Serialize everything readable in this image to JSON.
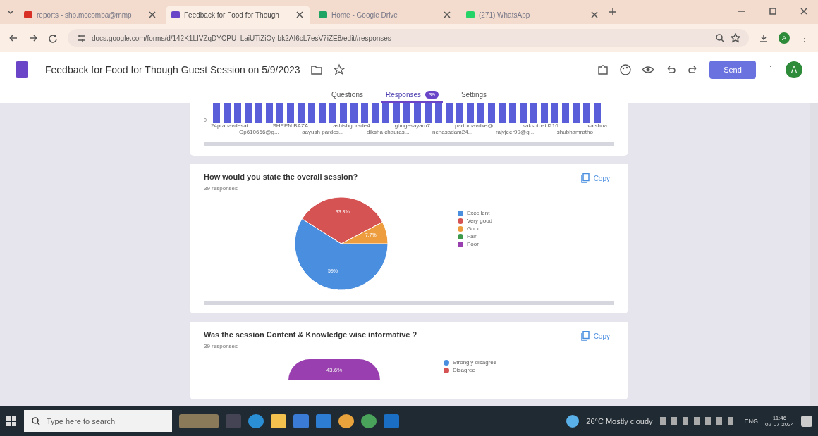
{
  "browser": {
    "tabs": [
      {
        "title": "reports - shp.mccomba@mmp",
        "selected": false
      },
      {
        "title": "Feedback for Food for Though",
        "selected": true
      },
      {
        "title": "Home - Google Drive",
        "selected": false
      },
      {
        "title": "(271) WhatsApp",
        "selected": false
      }
    ],
    "url": "docs.google.com/forms/d/142K1LIVZqDYCPU_LaiUTiZiOy-bk2AI6cL7esV7iZE8/edit#responses",
    "profile_initial": "A"
  },
  "form": {
    "title": "Feedback for Food for Though Guest Session on 5/9/2023",
    "send_label": "Send",
    "avatar_initial": "A",
    "tabs": [
      {
        "label": "Questions",
        "selected": false
      },
      {
        "label": "Responses",
        "badge": "39",
        "selected": true
      },
      {
        "label": "Settings",
        "selected": false
      }
    ]
  },
  "name_chart": {
    "axis_zero": "0",
    "labels_row_1": [
      "24pranavdesai",
      "SHEEN BAZA",
      "ashishgorade4",
      "ghugesayam7",
      "parthmavdke@...",
      "sakshipatil216...",
      "vaishna"
    ],
    "labels_row_2": [
      "Gp610666@g...",
      "aayush pardes...",
      "diksha chauras...",
      "nehasadam24...",
      "rajvjeer99@g...",
      "shubhamratho"
    ]
  },
  "questions": [
    {
      "title": "How would you state the overall session?",
      "responses": "39 responses",
      "copy_label": "Copy",
      "chart_data": {
        "type": "pie",
        "categories": [
          "Excellent",
          "Very good",
          "Good",
          "Fair",
          "Poor"
        ],
        "colors": [
          "#4a8ee0",
          "#d55353",
          "#ee9d3e",
          "#3d9a4a",
          "#9a3fb0"
        ],
        "values": [
          59,
          33.3,
          7.7,
          0,
          0
        ],
        "value_labels": [
          "59%",
          "33.3%",
          "7.7%",
          null,
          null
        ]
      }
    },
    {
      "title": "Was the session Content & Knowledge wise informative ?",
      "responses": "39 responses",
      "copy_label": "Copy",
      "slice_label": "43.6%",
      "legend": [
        {
          "label": "Strongly disagree",
          "color": "#4a8ee0"
        },
        {
          "label": "Disagree",
          "color": "#d55353"
        }
      ]
    }
  ],
  "taskbar": {
    "search_placeholder": "Type here to search",
    "weather": "26°C  Mostly cloudy",
    "language": "ENG",
    "time": "11:46",
    "date": "02-07-2024"
  }
}
